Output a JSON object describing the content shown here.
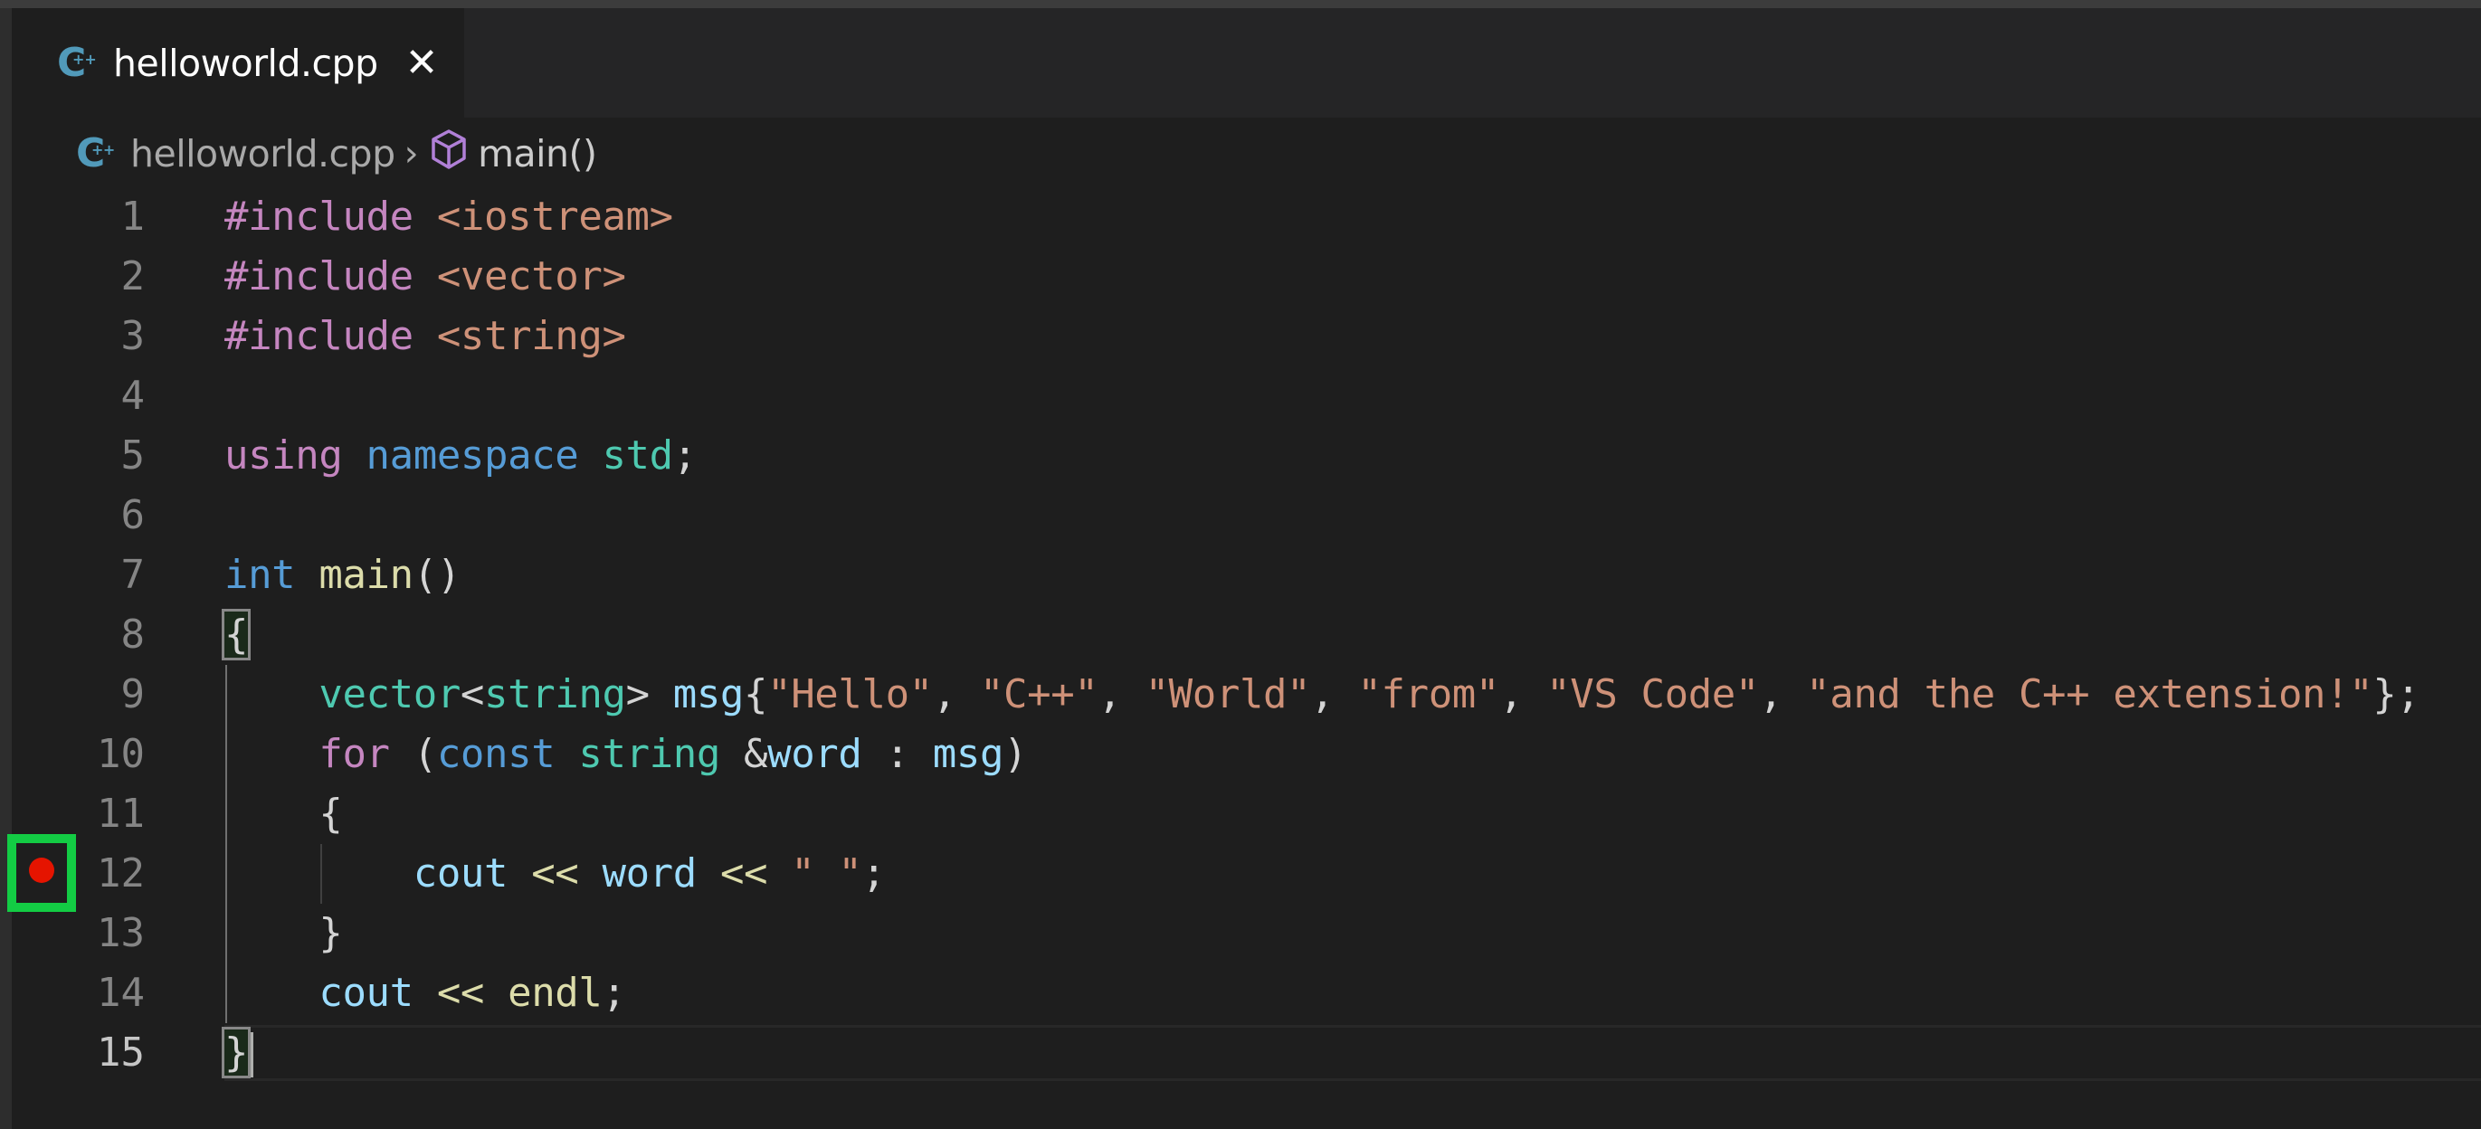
{
  "window": {
    "tab": {
      "filename": "helloworld.cpp",
      "icon": "cpp-file-icon",
      "close_icon": "close-icon",
      "close_glyph": "✕"
    },
    "breadcrumb": {
      "file": "helloworld.cpp",
      "separator": "›",
      "symbol_icon": "method-cube-icon",
      "symbol": "main()"
    }
  },
  "editor": {
    "current_line": 15,
    "breakpoint_line": 12,
    "breakpoint_color": "#e51400",
    "highlight_box_color": "#13cc44",
    "lines": [
      {
        "n": "1",
        "tokens": [
          [
            "kw-pre",
            "#include"
          ],
          [
            "punc",
            " "
          ],
          [
            "inc",
            "<iostream>"
          ]
        ]
      },
      {
        "n": "2",
        "tokens": [
          [
            "kw-pre",
            "#include"
          ],
          [
            "punc",
            " "
          ],
          [
            "inc",
            "<vector>"
          ]
        ]
      },
      {
        "n": "3",
        "tokens": [
          [
            "kw-pre",
            "#include"
          ],
          [
            "punc",
            " "
          ],
          [
            "inc",
            "<string>"
          ]
        ]
      },
      {
        "n": "4",
        "tokens": []
      },
      {
        "n": "5",
        "tokens": [
          [
            "kw-pre",
            "using"
          ],
          [
            "punc",
            " "
          ],
          [
            "kw",
            "namespace"
          ],
          [
            "punc",
            " "
          ],
          [
            "type",
            "std"
          ],
          [
            "punc",
            ";"
          ]
        ]
      },
      {
        "n": "6",
        "tokens": []
      },
      {
        "n": "7",
        "tokens": [
          [
            "kw",
            "int"
          ],
          [
            "punc",
            " "
          ],
          [
            "fn-c",
            "main"
          ],
          [
            "punc",
            "()"
          ]
        ]
      },
      {
        "n": "8",
        "tokens": [
          [
            "bracket",
            "{"
          ]
        ]
      },
      {
        "n": "9",
        "tokens": [
          [
            "punc",
            "    "
          ],
          [
            "type",
            "vector"
          ],
          [
            "punc",
            "<"
          ],
          [
            "type",
            "string"
          ],
          [
            "punc",
            "> "
          ],
          [
            "var",
            "msg"
          ],
          [
            "punc",
            "{"
          ],
          [
            "str",
            "\"Hello\""
          ],
          [
            "punc",
            ", "
          ],
          [
            "str",
            "\"C++\""
          ],
          [
            "punc",
            ", "
          ],
          [
            "str",
            "\"World\""
          ],
          [
            "punc",
            ", "
          ],
          [
            "str",
            "\"from\""
          ],
          [
            "punc",
            ", "
          ],
          [
            "str",
            "\"VS Code\""
          ],
          [
            "punc",
            ", "
          ],
          [
            "str",
            "\"and the C++ extension!\""
          ],
          [
            "punc",
            "};"
          ]
        ]
      },
      {
        "n": "10",
        "tokens": [
          [
            "punc",
            "    "
          ],
          [
            "kw-pre",
            "for"
          ],
          [
            "punc",
            " ("
          ],
          [
            "kw",
            "const"
          ],
          [
            "punc",
            " "
          ],
          [
            "type",
            "string"
          ],
          [
            "punc",
            " &"
          ],
          [
            "var",
            "word"
          ],
          [
            "punc",
            " : "
          ],
          [
            "var",
            "msg"
          ],
          [
            "punc",
            ")"
          ]
        ]
      },
      {
        "n": "11",
        "tokens": [
          [
            "punc",
            "    {"
          ]
        ]
      },
      {
        "n": "12",
        "tokens": [
          [
            "punc",
            "        "
          ],
          [
            "var",
            "cout"
          ],
          [
            "punc",
            " "
          ],
          [
            "fn-c",
            "<<"
          ],
          [
            "punc",
            " "
          ],
          [
            "var",
            "word"
          ],
          [
            "punc",
            " "
          ],
          [
            "fn-c",
            "<<"
          ],
          [
            "punc",
            " "
          ],
          [
            "str",
            "\" \""
          ],
          [
            "punc",
            ";"
          ]
        ]
      },
      {
        "n": "13",
        "tokens": [
          [
            "punc",
            "    }"
          ]
        ]
      },
      {
        "n": "14",
        "tokens": [
          [
            "punc",
            "    "
          ],
          [
            "var",
            "cout"
          ],
          [
            "punc",
            " "
          ],
          [
            "fn-c",
            "<<"
          ],
          [
            "punc",
            " "
          ],
          [
            "fn-c",
            "endl"
          ],
          [
            "punc",
            ";"
          ]
        ]
      },
      {
        "n": "15",
        "tokens": [
          [
            "bracket",
            "}"
          ],
          [
            "cursor",
            ""
          ]
        ]
      }
    ]
  }
}
